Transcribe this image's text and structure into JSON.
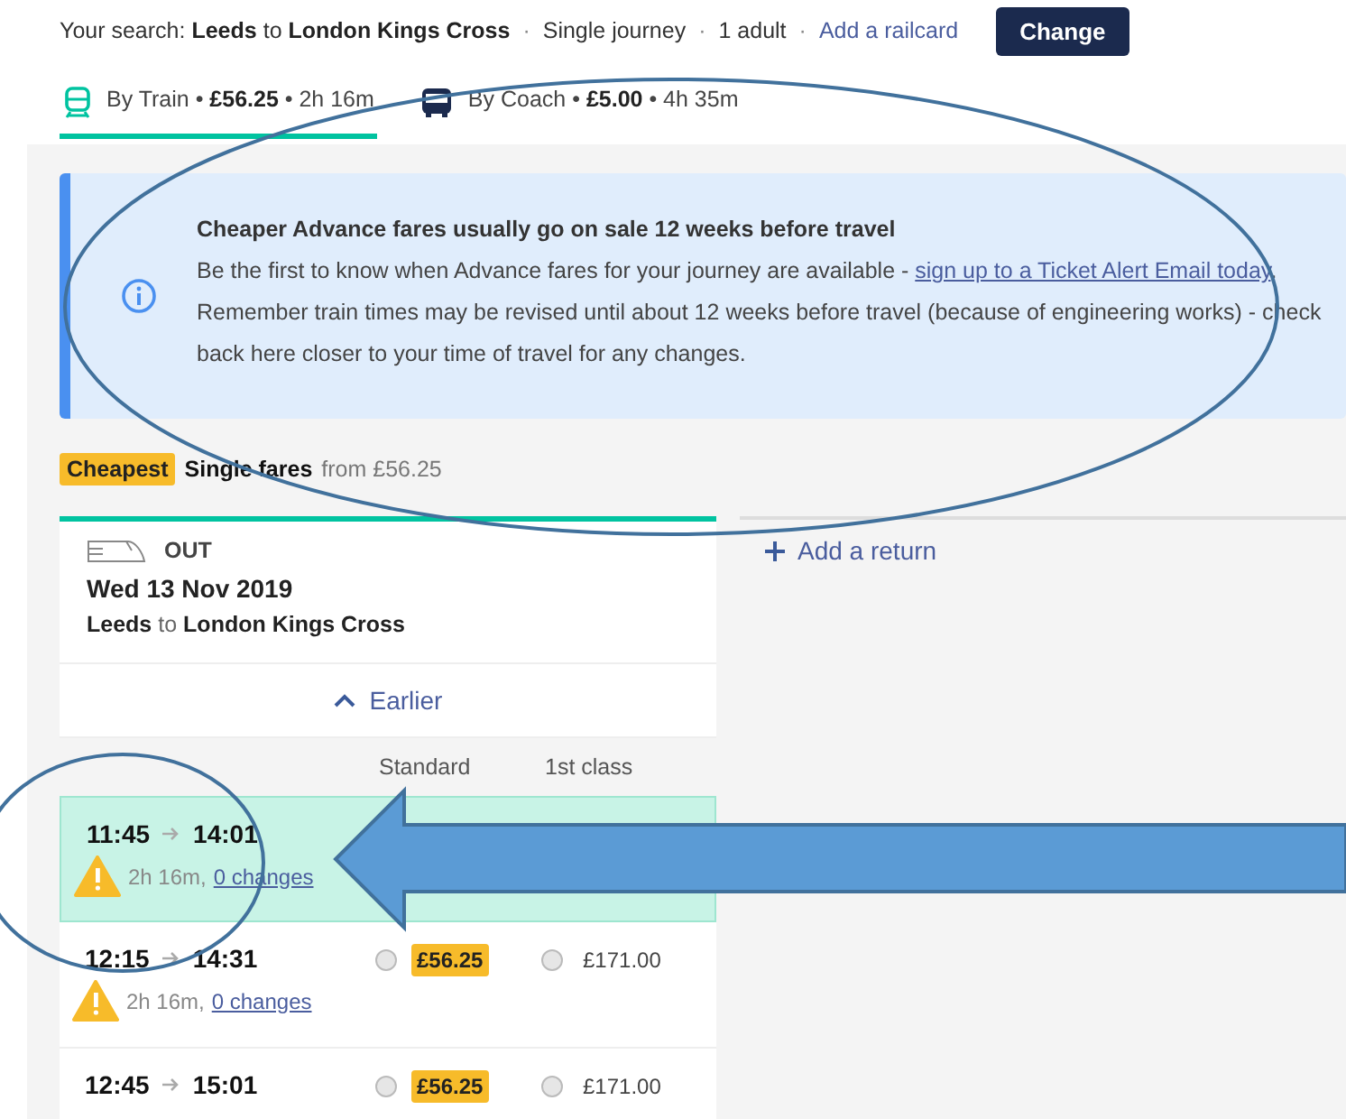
{
  "search": {
    "label": "Your search:",
    "origin": "Leeds",
    "connector": "to",
    "destination": "London Kings Cross",
    "journey": "Single journey",
    "passengers": "1 adult",
    "railcard_link": "Add a railcard",
    "button": "Change",
    "separators": [
      "·",
      "·",
      "·"
    ]
  },
  "tabs": [
    {
      "kind": "train",
      "text": "By Train • **£56.25** • 2h 16m",
      "selected": true
    },
    {
      "kind": "coach",
      "text": "By Coach • **£5.00** • 4h 35m",
      "selected": false
    }
  ],
  "notice": {
    "title": "Cheaper Advance fares usually go on sale 12 weeks before travel",
    "text": "Be the first to know when Advance fares for your journey are available - ",
    "link": "sign up to a Ticket Alert Email today",
    "after": ". Remember train times may be revised until about 12 weeks before travel (because of engineering works) - check back here closer to your time of travel for any changes."
  },
  "fares_heading": {
    "badge": "Cheapest",
    "title": "Single fares",
    "from": "from £56.25"
  },
  "outbound": {
    "direction": "OUT",
    "date": "Wed 13 Nov 2019",
    "origin": "Leeds",
    "connector": "to",
    "destination": "London Kings Cross",
    "earlier": "Earlier",
    "columns": [
      "Standard",
      "1st class"
    ],
    "rows": [
      {
        "depart": "11:45",
        "arrive": "14:01",
        "duration": "2h 16m,",
        "changes": "0 changes",
        "warning": true,
        "selected": true
      },
      {
        "depart": "12:15",
        "arrive": "14:31",
        "duration": "2h 16m,",
        "changes": "0 changes",
        "warning": true,
        "selected": false,
        "fares": [
          {
            "price": "£56.25",
            "cheapest": true,
            "selected": false
          },
          {
            "price": "£171.00",
            "cheapest": false,
            "selected": false
          }
        ]
      },
      {
        "depart": "12:45",
        "arrive": "15:01",
        "warning": false,
        "selected": false,
        "fares": [
          {
            "price": "£56.25",
            "cheapest": true,
            "selected": false
          },
          {
            "price": "£171.00",
            "cheapest": false,
            "selected": false
          }
        ]
      }
    ]
  },
  "return_link": "Add a return"
}
